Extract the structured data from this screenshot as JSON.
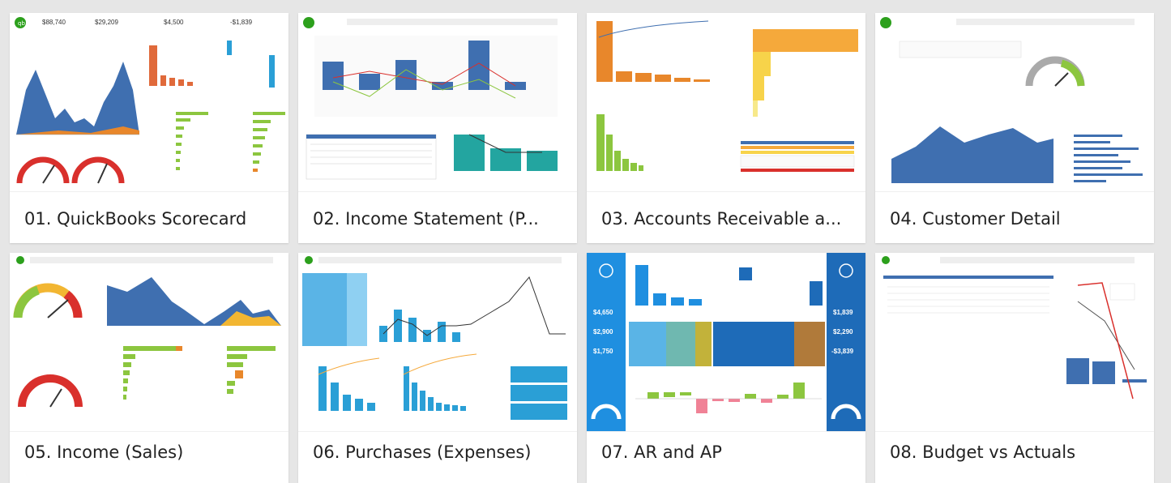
{
  "colors": {
    "background": "#e6e6e6",
    "card": "#ffffff",
    "quickbooks_green": "#2ca01c",
    "primary_blue": "#3f6fb0",
    "teal": "#23a5a0",
    "orange": "#e8872b",
    "sky_blue": "#2a9fd6",
    "lime": "#8cc63f",
    "red": "#d9302c"
  },
  "dashboards": [
    {
      "caption": "01. QuickBooks Scorecard",
      "logo_icon": "quickbooks-logo-icon",
      "kpis": [
        "$88,740",
        "$29,209",
        "$4,500",
        "-$1,839"
      ]
    },
    {
      "caption": "02. Income Statement (P...",
      "logo_icon": "quickbooks-logo-icon"
    },
    {
      "caption": "03. Accounts Receivable a...",
      "logo_icon": "quickbooks-logo-icon"
    },
    {
      "caption": "04. Customer Detail",
      "logo_icon": "quickbooks-logo-icon"
    },
    {
      "caption": "05. Income (Sales)",
      "logo_icon": "quickbooks-logo-icon"
    },
    {
      "caption": "06. Purchases (Expenses)",
      "logo_icon": "quickbooks-logo-icon"
    },
    {
      "caption": "07. AR and AP",
      "logo_icon": "quickbooks-logo-icon",
      "kpis": [
        "$4,650",
        "$2,900",
        "$1,750",
        "$1,839",
        "$2,290",
        "-$3,839"
      ]
    },
    {
      "caption": "08. Budget vs Actuals",
      "logo_icon": "quickbooks-logo-icon"
    }
  ]
}
